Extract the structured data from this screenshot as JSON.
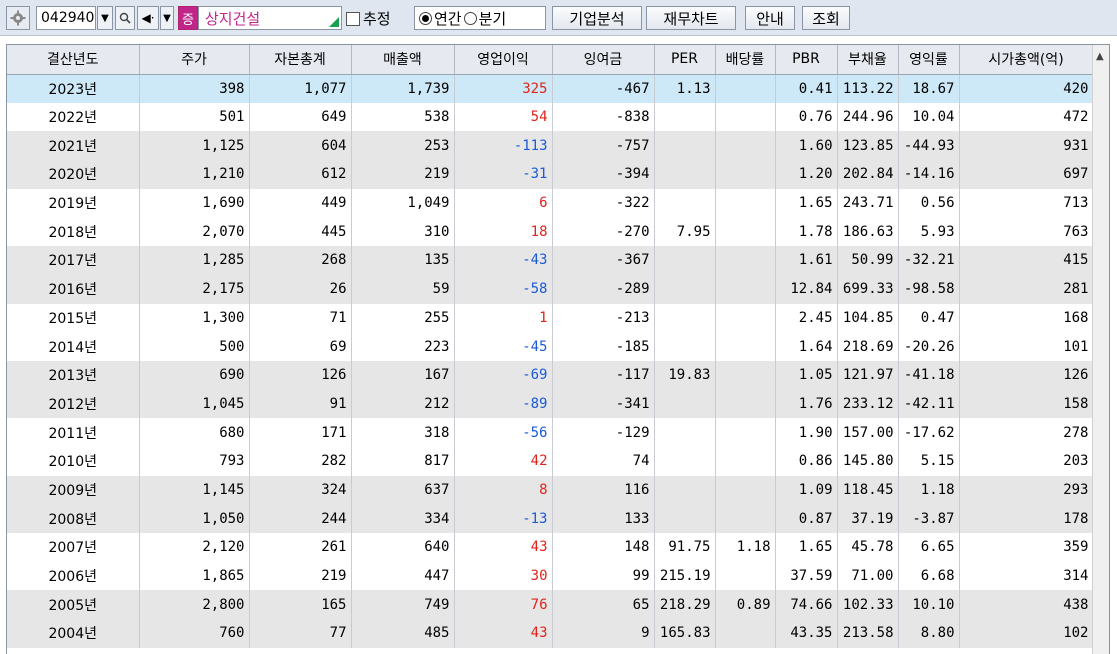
{
  "toolbar": {
    "stock_code": "042940",
    "market_badge": "증",
    "company_name": "상지건설",
    "estimate_label": "추정",
    "radio_annual": "연간",
    "radio_quarter": "분기",
    "btn_company_analysis": "기업분석",
    "btn_financial_chart": "재무차트",
    "btn_guide": "안내",
    "btn_query": "조회"
  },
  "table": {
    "headers": [
      "결산년도",
      "주가",
      "자본총계",
      "매출액",
      "영업이익",
      "잉여금",
      "PER",
      "배당률",
      "PBR",
      "부채율",
      "영익률",
      "시가총액(억)"
    ],
    "rows": [
      {
        "year": "2023년",
        "price": "398",
        "equity": "1,077",
        "sales": "1,739",
        "op": "325",
        "surplus": "-467",
        "per": "1.13",
        "div": "",
        "pbr": "0.41",
        "debt": "113.22",
        "opm": "18.67",
        "mcap": "420"
      },
      {
        "year": "2022년",
        "price": "501",
        "equity": "649",
        "sales": "538",
        "op": "54",
        "surplus": "-838",
        "per": "",
        "div": "",
        "pbr": "0.76",
        "debt": "244.96",
        "opm": "10.04",
        "mcap": "472"
      },
      {
        "year": "2021년",
        "price": "1,125",
        "equity": "604",
        "sales": "253",
        "op": "-113",
        "surplus": "-757",
        "per": "",
        "div": "",
        "pbr": "1.60",
        "debt": "123.85",
        "opm": "-44.93",
        "mcap": "931"
      },
      {
        "year": "2020년",
        "price": "1,210",
        "equity": "612",
        "sales": "219",
        "op": "-31",
        "surplus": "-394",
        "per": "",
        "div": "",
        "pbr": "1.20",
        "debt": "202.84",
        "opm": "-14.16",
        "mcap": "697"
      },
      {
        "year": "2019년",
        "price": "1,690",
        "equity": "449",
        "sales": "1,049",
        "op": "6",
        "surplus": "-322",
        "per": "",
        "div": "",
        "pbr": "1.65",
        "debt": "243.71",
        "opm": "0.56",
        "mcap": "713"
      },
      {
        "year": "2018년",
        "price": "2,070",
        "equity": "445",
        "sales": "310",
        "op": "18",
        "surplus": "-270",
        "per": "7.95",
        "div": "",
        "pbr": "1.78",
        "debt": "186.63",
        "opm": "5.93",
        "mcap": "763"
      },
      {
        "year": "2017년",
        "price": "1,285",
        "equity": "268",
        "sales": "135",
        "op": "-43",
        "surplus": "-367",
        "per": "",
        "div": "",
        "pbr": "1.61",
        "debt": "50.99",
        "opm": "-32.21",
        "mcap": "415"
      },
      {
        "year": "2016년",
        "price": "2,175",
        "equity": "26",
        "sales": "59",
        "op": "-58",
        "surplus": "-289",
        "per": "",
        "div": "",
        "pbr": "12.84",
        "debt": "699.33",
        "opm": "-98.58",
        "mcap": "281"
      },
      {
        "year": "2015년",
        "price": "1,300",
        "equity": "71",
        "sales": "255",
        "op": "1",
        "surplus": "-213",
        "per": "",
        "div": "",
        "pbr": "2.45",
        "debt": "104.85",
        "opm": "0.47",
        "mcap": "168"
      },
      {
        "year": "2014년",
        "price": "500",
        "equity": "69",
        "sales": "223",
        "op": "-45",
        "surplus": "-185",
        "per": "",
        "div": "",
        "pbr": "1.64",
        "debt": "218.69",
        "opm": "-20.26",
        "mcap": "101"
      },
      {
        "year": "2013년",
        "price": "690",
        "equity": "126",
        "sales": "167",
        "op": "-69",
        "surplus": "-117",
        "per": "19.83",
        "div": "",
        "pbr": "1.05",
        "debt": "121.97",
        "opm": "-41.18",
        "mcap": "126"
      },
      {
        "year": "2012년",
        "price": "1,045",
        "equity": "91",
        "sales": "212",
        "op": "-89",
        "surplus": "-341",
        "per": "",
        "div": "",
        "pbr": "1.76",
        "debt": "233.12",
        "opm": "-42.11",
        "mcap": "158"
      },
      {
        "year": "2011년",
        "price": "680",
        "equity": "171",
        "sales": "318",
        "op": "-56",
        "surplus": "-129",
        "per": "",
        "div": "",
        "pbr": "1.90",
        "debt": "157.00",
        "opm": "-17.62",
        "mcap": "278"
      },
      {
        "year": "2010년",
        "price": "793",
        "equity": "282",
        "sales": "817",
        "op": "42",
        "surplus": "74",
        "per": "",
        "div": "",
        "pbr": "0.86",
        "debt": "145.80",
        "opm": "5.15",
        "mcap": "203"
      },
      {
        "year": "2009년",
        "price": "1,145",
        "equity": "324",
        "sales": "637",
        "op": "8",
        "surplus": "116",
        "per": "",
        "div": "",
        "pbr": "1.09",
        "debt": "118.45",
        "opm": "1.18",
        "mcap": "293"
      },
      {
        "year": "2008년",
        "price": "1,050",
        "equity": "244",
        "sales": "334",
        "op": "-13",
        "surplus": "133",
        "per": "",
        "div": "",
        "pbr": "0.87",
        "debt": "37.19",
        "opm": "-3.87",
        "mcap": "178"
      },
      {
        "year": "2007년",
        "price": "2,120",
        "equity": "261",
        "sales": "640",
        "op": "43",
        "surplus": "148",
        "per": "91.75",
        "div": "1.18",
        "pbr": "1.65",
        "debt": "45.78",
        "opm": "6.65",
        "mcap": "359"
      },
      {
        "year": "2006년",
        "price": "1,865",
        "equity": "219",
        "sales": "447",
        "op": "30",
        "surplus": "99",
        "per": "215.19",
        "div": "",
        "pbr": "37.59",
        "debt": "71.00",
        "opm": "6.68",
        "mcap": "314"
      },
      {
        "year": "2005년",
        "price": "2,800",
        "equity": "165",
        "sales": "749",
        "op": "76",
        "surplus": "65",
        "per": "218.29",
        "div": "0.89",
        "pbr": "74.66",
        "debt": "102.33",
        "opm": "10.10",
        "mcap": "438"
      },
      {
        "year": "2004년",
        "price": "760",
        "equity": "77",
        "sales": "485",
        "op": "43",
        "surplus": "9",
        "per": "165.83",
        "div": "",
        "pbr": "43.35",
        "debt": "213.58",
        "opm": "8.80",
        "mcap": "102"
      }
    ]
  },
  "colors": {
    "positive_text": "#e0241c",
    "negative_text": "#1c5ad8",
    "selected_row": "#cde8f6",
    "band_row": "#e6e6e6",
    "brand_badge": "#c0268a"
  }
}
